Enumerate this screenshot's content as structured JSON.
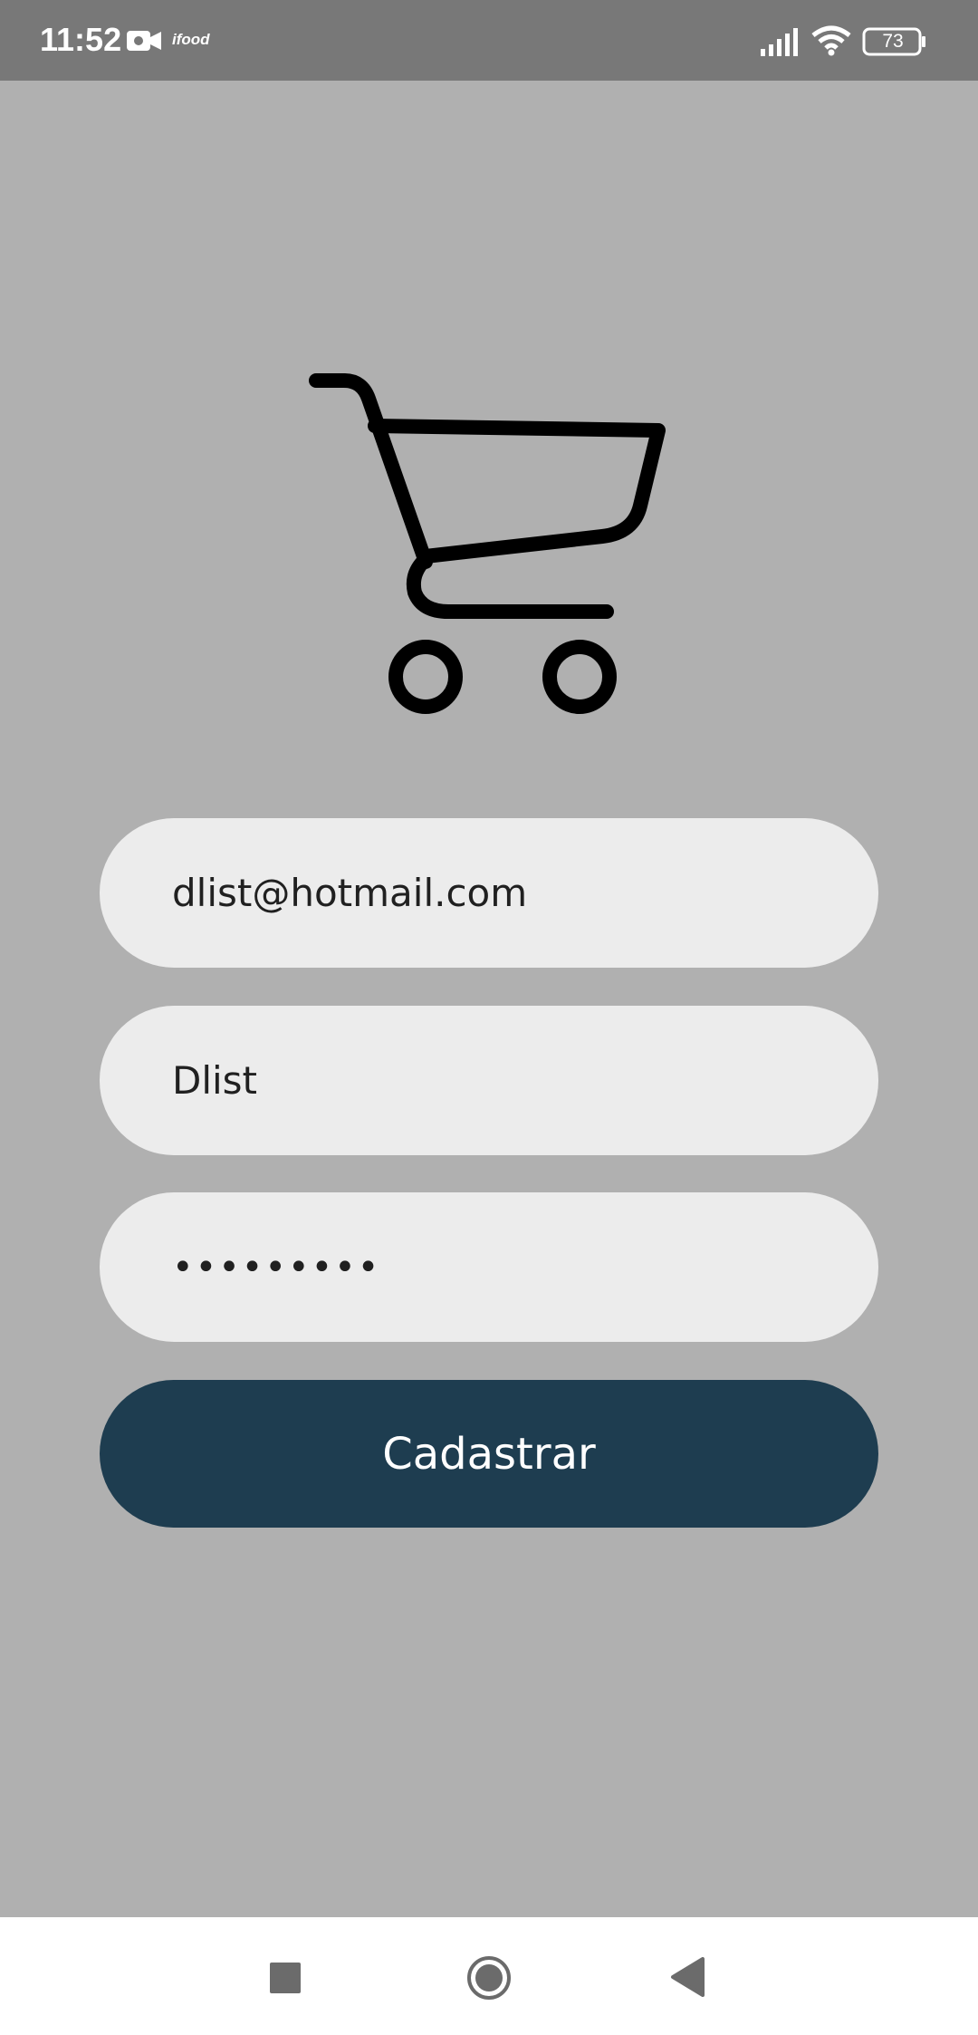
{
  "status_bar": {
    "time": "11:52",
    "app_indicator": "ifood",
    "battery_level": "73",
    "icons": [
      "video-camera-icon",
      "signal-icon",
      "wifi-icon",
      "battery-icon"
    ]
  },
  "logo": {
    "icon": "shopping-cart-icon"
  },
  "form": {
    "email_value": "dlist@hotmail.com",
    "name_value": "Dlist",
    "password_value": "•••••••••",
    "submit_label": "Cadastrar"
  },
  "colors": {
    "background": "#b0b0b0",
    "status_bar": "#787878",
    "input_background": "#ececec",
    "button_background": "#1e3d50",
    "button_text": "#ffffff"
  },
  "navigation": {
    "icons": [
      "recent-apps-icon",
      "home-icon",
      "back-icon"
    ]
  }
}
